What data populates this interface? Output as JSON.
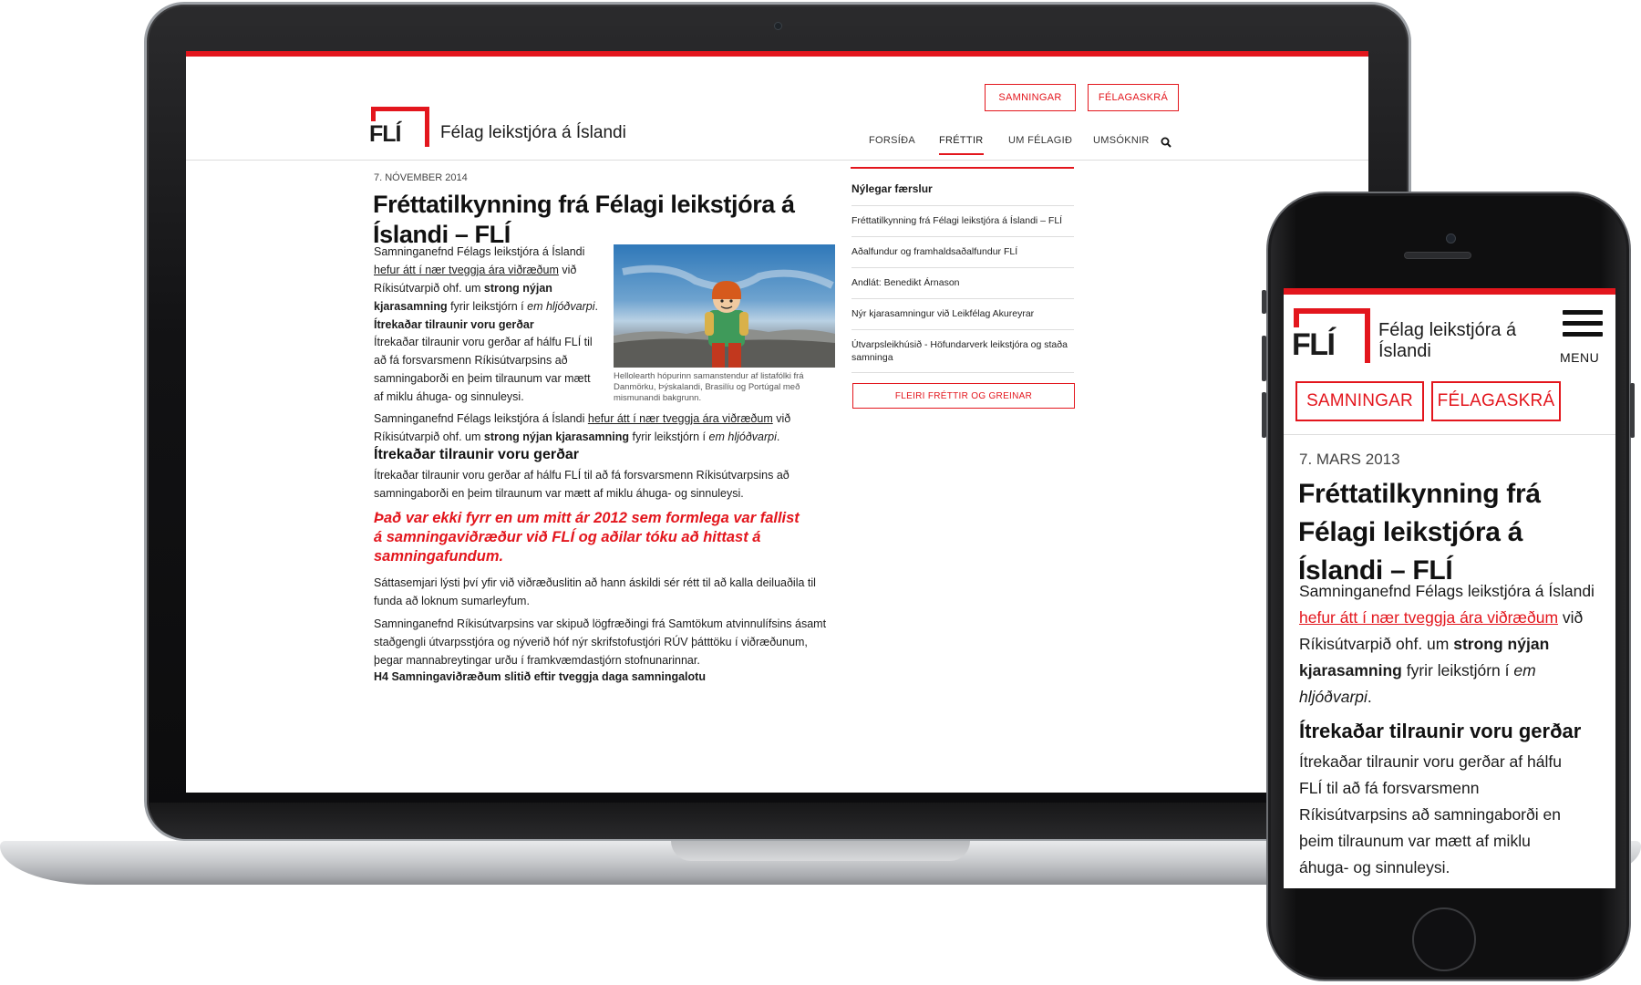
{
  "desktop": {
    "top_buttons": [
      "SAMNINGAR",
      "FÉLAGASKRÁ"
    ],
    "logo_text": "FLÍ",
    "site_title": "Félag leikstjóra á Íslandi",
    "nav": [
      "FORSÍÐA",
      "FRÉTTIR",
      "UM FÉLAGIÐ",
      "UMSÓKNIR"
    ],
    "article": {
      "date": "7. NÓVEMBER 2014",
      "title": "Fréttatilkynning frá Félagi leikstjóra á Íslandi – FLÍ",
      "p1": {
        "a": "Samninganefnd Félags leikstjóra á Íslandi",
        "link": "hefur átt í nær tveggja ára viðræðum",
        "b": "við Ríkisútvarpið ohf. um",
        "bold": "strong nýjan kjarasamning",
        "c": "fyrir leikstjórn í",
        "italic": "em hljóðvarpi",
        "d": "."
      },
      "h_small": "Ítrekaðar tilraunir voru gerðar",
      "p2": "Ítrekaðar tilraunir voru gerðar af hálfu FLÍ til að fá forsvarsmenn Ríkisútvarpsins að samningaborði en þeim tilraunum var mætt af miklu áhuga- og sinnuleysi.",
      "image_caption": "Hellolearth hópurinn samanstendur af listafólki frá Danmörku, Þýskalandi, Brasilíu og Portúgal með mismunandi bakgrunn.",
      "p3": {
        "a": "Samninganefnd Félags leikstjóra á Íslandi",
        "link": "hefur átt í nær tveggja ára viðræðum",
        "b": "við Ríkisútvarpið ohf. um",
        "bold": "strong nýjan kjarasamning",
        "c": "fyrir leikstjórn í",
        "italic": "em hljóðvarpi",
        "d": "."
      },
      "h3": "Ítrekaðar tilraunir voru gerðar",
      "p4": "Ítrekaðar tilraunir voru gerðar af hálfu FLÍ til að fá forsvarsmenn Ríkisútvarpsins að samningaborði en þeim tilraunum var mætt af miklu áhuga- og sinnuleysi.",
      "red_quote": "Það var ekki fyrr en um mitt ár 2012 sem formlega var fallist á samningaviðræður við FLÍ og aðilar tóku að hittast á samningafundum.",
      "p5": "Sáttasemjari lýsti því yfir við viðræðuslitin að hann áskildi sér rétt til að kalla deiluaðila til funda að loknum sumarleyfum.",
      "p6": "Samninganefnd Ríkisútvarpsins var skipuð lögfræðingi frá Samtökum atvinnulífsins ásamt staðgengli útvarpsstjóra og nýverið hóf nýr skrifstofustjóri RÚV þátttöku í viðræðunum, þegar mannabreytingar urðu í framkvæmdastjórn stofnunarinnar.",
      "h4": "H4 Samningaviðræðum slitið eftir tveggja daga samningalotu"
    },
    "sidebar": {
      "title": "Nýlegar færslur",
      "items": [
        "Fréttatilkynning frá Félagi leikstjóra á Íslandi – FLÍ",
        "Aðalfundur og framhaldsaðalfundur FLÍ",
        "Andlát: Benedikt Árnason",
        "Nýr kjarasamningur við Leikfélag Akureyrar",
        "Útvarpsleikhúsið - Höfundarverk leikstjóra og staða samninga"
      ],
      "more_button": "FLEIRI FRÉTTIR OG GREINAR"
    }
  },
  "mobile": {
    "logo_text": "FLÍ",
    "site_title": "Félag leikstjóra á Íslandi",
    "menu_label": "MENU",
    "buttons": [
      "SAMNINGAR",
      "FÉLAGASKRÁ"
    ],
    "date": "7. MARS 2013",
    "title": "Fréttatilkynning frá Félagi leikstjóra á Íslandi – FLÍ",
    "p1": {
      "a": "Samninganefnd Félags leikstjóra á Íslandi",
      "link": "hefur átt í nær tveggja ára viðræðum",
      "b": "við Ríkisútvarpið ohf. um",
      "bold": "strong nýjan kjarasamning",
      "c": "fyrir leikstjórn í",
      "italic": "em hljóðvarpi",
      "d": "."
    },
    "h3": "Ítrekaðar tilraunir voru gerðar",
    "p2": "Ítrekaðar tilraunir voru gerðar af hálfu FLÍ til að fá forsvarsmenn Ríkisútvarpsins að samningaborði en þeim tilraunum var mætt af miklu áhuga- og sinnuleysi."
  },
  "colors": {
    "accent": "#e3161d",
    "text": "#1b1b1b"
  }
}
